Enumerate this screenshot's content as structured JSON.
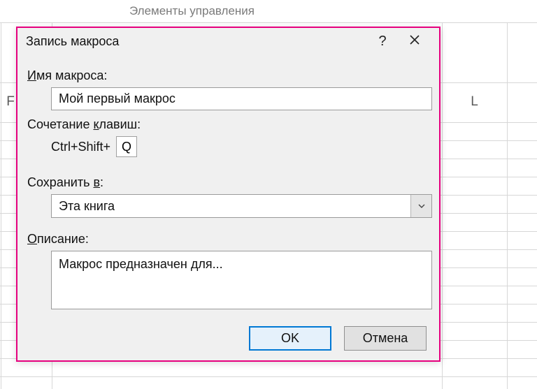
{
  "ribbon_group_label": "Элементы управления",
  "columns": {
    "F": "F",
    "L": "L"
  },
  "dialog": {
    "title": "Запись макроса",
    "help_symbol": "?",
    "labels": {
      "name_prefix_u": "И",
      "name_rest": "мя макроса:",
      "shortcut_prefix_plain": "Сочетание ",
      "shortcut_u": "к",
      "shortcut_rest": "лавиш:",
      "shortcut_fixed": "Ctrl+Shift+",
      "store_prefix_plain": "Сохранить ",
      "store_u": "в",
      "store_rest": ":",
      "desc_u": "О",
      "desc_rest": "писание:"
    },
    "name_value": "Мой первый макрос",
    "shortcut_key": "Q",
    "store_value": "Эта книга",
    "description_value": "Макрос предназначен для...",
    "buttons": {
      "ok": "OK",
      "cancel": "Отмена"
    }
  }
}
